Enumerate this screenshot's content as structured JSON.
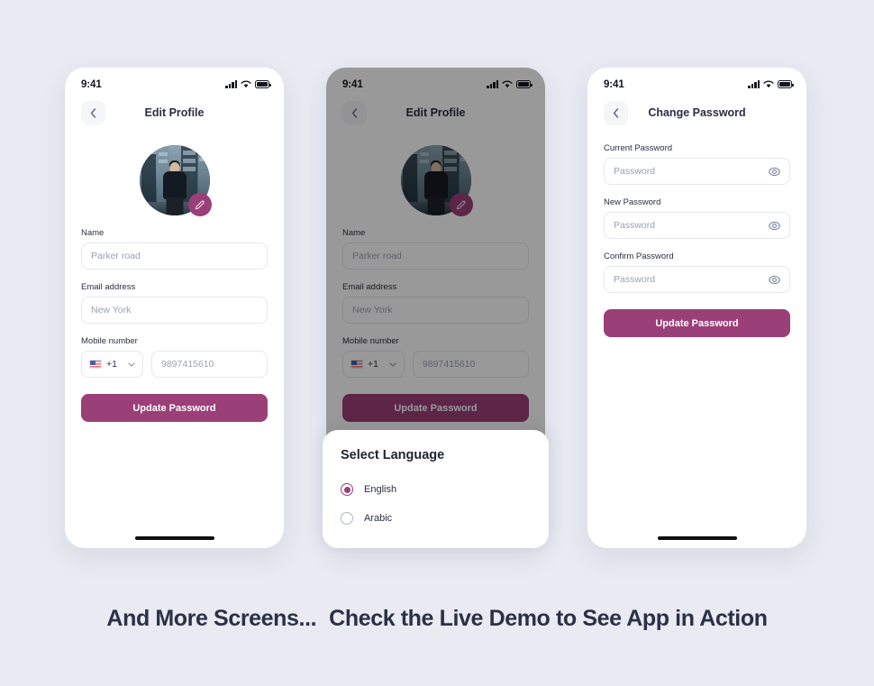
{
  "page": {
    "background_color": "#e9eaf2",
    "accent_color": "#9b3f78",
    "caption_part1": "And More Screens...",
    "caption_part2": "Check the Live Demo to See App in Action"
  },
  "status_bar": {
    "time": "9:41",
    "signal_icon": "cellular-signal-icon",
    "wifi_icon": "wifi-icon",
    "battery_icon": "battery-icon"
  },
  "screens": [
    {
      "id": "edit-profile",
      "title": "Edit Profile",
      "back_icon": "chevron-left-icon",
      "avatar": {
        "name": "profile-avatar",
        "edit_badge_icon": "pencil-edit-icon"
      },
      "fields": [
        {
          "label": "Name",
          "placeholder": "Parker road"
        },
        {
          "label": "Email address",
          "placeholder": "New York"
        }
      ],
      "mobile": {
        "label": "Mobile number",
        "country_code": "+1",
        "flag_icon": "us-flag-icon",
        "chevron_icon": "chevron-down-icon",
        "placeholder": "9897415610"
      },
      "submit_label": "Update Password"
    },
    {
      "id": "edit-profile-dimmed",
      "title": "Edit Profile",
      "back_icon": "chevron-left-icon",
      "avatar": {
        "name": "profile-avatar",
        "edit_badge_icon": "pencil-edit-icon"
      },
      "fields": [
        {
          "label": "Name",
          "placeholder": "Parker road"
        },
        {
          "label": "Email address",
          "placeholder": "New York"
        }
      ],
      "mobile": {
        "label": "Mobile number",
        "country_code": "+1",
        "flag_icon": "us-flag-icon",
        "chevron_icon": "chevron-down-icon",
        "placeholder": "9897415610"
      },
      "submit_label": "Update Password"
    },
    {
      "id": "change-password",
      "title": "Change Password",
      "back_icon": "chevron-left-icon",
      "fields": [
        {
          "label": "Current Password",
          "placeholder": "Password",
          "icon": "eye-icon"
        },
        {
          "label": "New Password",
          "placeholder": "Password",
          "icon": "eye-icon"
        },
        {
          "label": "Confirm Password",
          "placeholder": "Password",
          "icon": "eye-icon"
        }
      ],
      "submit_label": "Update Password"
    }
  ],
  "language_sheet": {
    "title": "Select Language",
    "options": [
      {
        "label": "English",
        "selected": true
      },
      {
        "label": "Arabic",
        "selected": false
      }
    ]
  }
}
